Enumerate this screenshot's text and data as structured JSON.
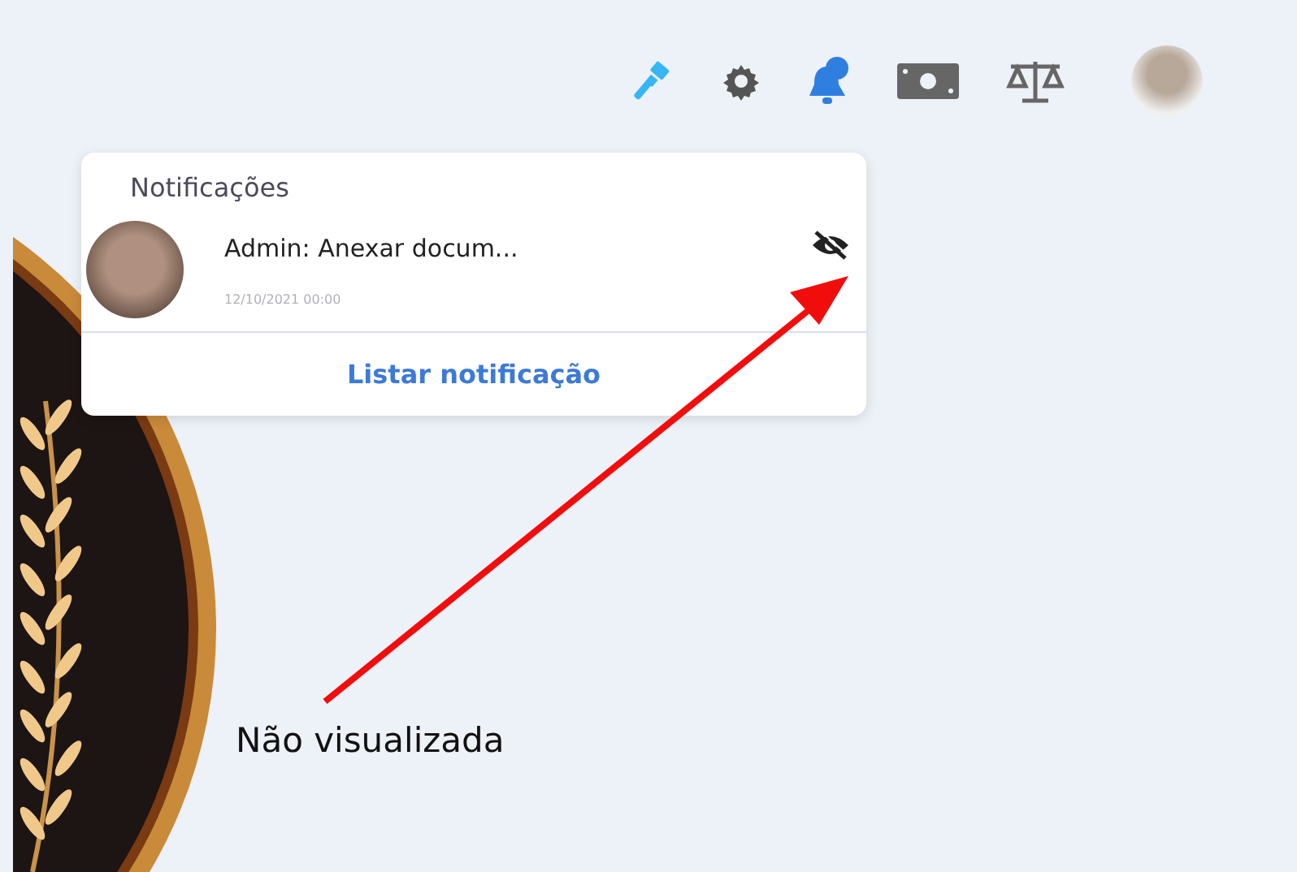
{
  "toolbar": {
    "icons": [
      {
        "kind": "gavel",
        "selected": false
      },
      {
        "kind": "gear",
        "selected": false
      },
      {
        "kind": "bell",
        "selected": true
      },
      {
        "kind": "money",
        "selected": false
      },
      {
        "kind": "scale",
        "selected": false
      },
      {
        "kind": "avatar",
        "selected": false
      }
    ]
  },
  "notifications": {
    "title": "Notificações",
    "items": [
      {
        "text": "Admin: Anexar docum...",
        "time": "12/10/2021 00:00",
        "seen": false
      }
    ],
    "link": "Listar notificação"
  },
  "annotation": {
    "label": "Não visualizada"
  }
}
